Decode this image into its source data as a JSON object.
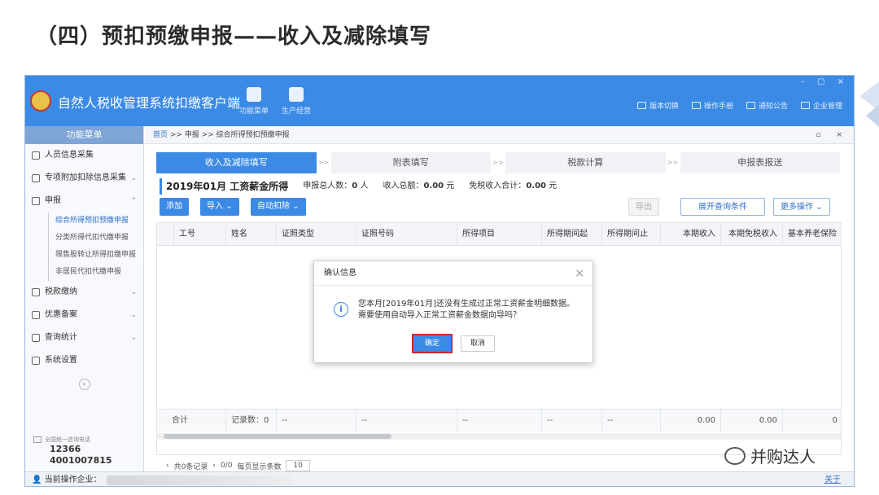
{
  "slide": {
    "title": "（四）预扣预缴申报——收入及减除填写",
    "watermark": "并购达人"
  },
  "app": {
    "title": "自然人税收管理系统扣缴客户端",
    "toolbar": [
      {
        "label": "功能菜单",
        "icon": "menu-icon"
      },
      {
        "label": "生产经营",
        "icon": "database-icon"
      }
    ],
    "topright": [
      {
        "label": "版本切换",
        "icon": "switch-icon"
      },
      {
        "label": "操作手册",
        "icon": "manual-icon"
      },
      {
        "label": "通知公告",
        "icon": "mail-icon"
      },
      {
        "label": "企业管理",
        "icon": "building-icon"
      }
    ],
    "window_controls": "– ▢ ×"
  },
  "sidebar": {
    "header": "功能菜单",
    "items": [
      {
        "label": "人员信息采集",
        "icon": "person-icon"
      },
      {
        "label": "专项附加扣除信息采集",
        "icon": "list-icon"
      },
      {
        "label": "申报",
        "icon": "grid-icon"
      },
      {
        "label": "税款缴纳",
        "icon": "grid-icon"
      },
      {
        "label": "优惠备案",
        "icon": "doc-icon"
      },
      {
        "label": "查询统计",
        "icon": "grid-icon"
      },
      {
        "label": "系统设置",
        "icon": "grid-icon"
      }
    ],
    "sub_items": [
      "综合所得预扣预缴申报",
      "分类所得代扣代缴申报",
      "限售股转让所得扣缴申报",
      "非居民代扣代缴申报"
    ],
    "hotline_label": "全国统一咨询电话",
    "hotline_1": "12366",
    "hotline_2": "4001007815"
  },
  "main": {
    "breadcrumb": {
      "home": "首页",
      "rest": " >> 申报 >> 综合所得预扣预缴申报"
    },
    "crumb_controls": "▫ ×",
    "steps": [
      "收入及减除填写",
      "附表填写",
      "税款计算",
      "申报表报送"
    ],
    "step_sep": ">>",
    "info": {
      "period": "2019年01月 工资薪金所得",
      "people_label": "申报总人数：",
      "people_value": "0",
      "people_unit": "人",
      "income_label": "收入总额：",
      "income_value": "0.00",
      "income_unit": "元",
      "exempt_label": "免税收入合计：",
      "exempt_value": "0.00",
      "exempt_unit": "元"
    },
    "actions": {
      "add": "添加",
      "import": "导入",
      "auto_deduct": "自动扣除",
      "export": "导出",
      "expand_query": "展开查询条件",
      "more": "更多操作"
    },
    "columns": [
      "工号",
      "姓名",
      "证照类型",
      "证照号码",
      "所得项目",
      "所得期间起",
      "所得期间止",
      "本期收入",
      "本期免税收入",
      "基本养老保险"
    ],
    "footer": {
      "total": "合计",
      "records": "记录数：0",
      "dash": "--",
      "income": "0.00",
      "exempt": "0.00",
      "last": "0"
    },
    "pager": {
      "total": "共0条记录",
      "page": "0/0",
      "per_page_label": "每页显示条数",
      "per_page": "10"
    }
  },
  "dialog": {
    "title": "确认信息",
    "line1": "您本月[2019年01月]还没有生成过正常工资薪金明细数据。",
    "line2": "需要使用自动导入正常工资薪金数据向导吗？",
    "ok": "确定",
    "cancel": "取消"
  },
  "status": {
    "current_label": "当前操作企业：",
    "about": "关于"
  },
  "colors": {
    "primary": "#3a8ae6",
    "highlight": "#d0282e"
  }
}
